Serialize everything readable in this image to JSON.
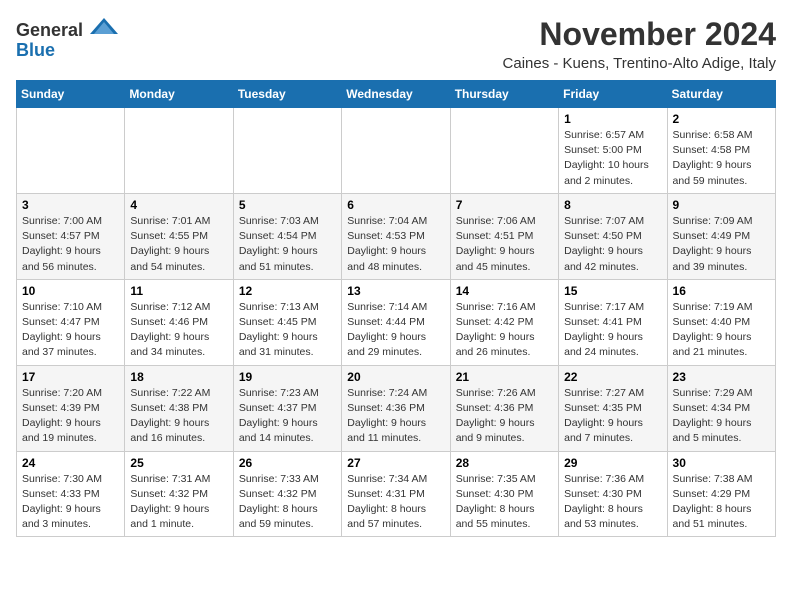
{
  "logo": {
    "general": "General",
    "blue": "Blue"
  },
  "title": "November 2024",
  "subtitle": "Caines - Kuens, Trentino-Alto Adige, Italy",
  "days_of_week": [
    "Sunday",
    "Monday",
    "Tuesday",
    "Wednesday",
    "Thursday",
    "Friday",
    "Saturday"
  ],
  "weeks": [
    [
      {
        "day": "",
        "detail": ""
      },
      {
        "day": "",
        "detail": ""
      },
      {
        "day": "",
        "detail": ""
      },
      {
        "day": "",
        "detail": ""
      },
      {
        "day": "",
        "detail": ""
      },
      {
        "day": "1",
        "detail": "Sunrise: 6:57 AM\nSunset: 5:00 PM\nDaylight: 10 hours and 2 minutes."
      },
      {
        "day": "2",
        "detail": "Sunrise: 6:58 AM\nSunset: 4:58 PM\nDaylight: 9 hours and 59 minutes."
      }
    ],
    [
      {
        "day": "3",
        "detail": "Sunrise: 7:00 AM\nSunset: 4:57 PM\nDaylight: 9 hours and 56 minutes."
      },
      {
        "day": "4",
        "detail": "Sunrise: 7:01 AM\nSunset: 4:55 PM\nDaylight: 9 hours and 54 minutes."
      },
      {
        "day": "5",
        "detail": "Sunrise: 7:03 AM\nSunset: 4:54 PM\nDaylight: 9 hours and 51 minutes."
      },
      {
        "day": "6",
        "detail": "Sunrise: 7:04 AM\nSunset: 4:53 PM\nDaylight: 9 hours and 48 minutes."
      },
      {
        "day": "7",
        "detail": "Sunrise: 7:06 AM\nSunset: 4:51 PM\nDaylight: 9 hours and 45 minutes."
      },
      {
        "day": "8",
        "detail": "Sunrise: 7:07 AM\nSunset: 4:50 PM\nDaylight: 9 hours and 42 minutes."
      },
      {
        "day": "9",
        "detail": "Sunrise: 7:09 AM\nSunset: 4:49 PM\nDaylight: 9 hours and 39 minutes."
      }
    ],
    [
      {
        "day": "10",
        "detail": "Sunrise: 7:10 AM\nSunset: 4:47 PM\nDaylight: 9 hours and 37 minutes."
      },
      {
        "day": "11",
        "detail": "Sunrise: 7:12 AM\nSunset: 4:46 PM\nDaylight: 9 hours and 34 minutes."
      },
      {
        "day": "12",
        "detail": "Sunrise: 7:13 AM\nSunset: 4:45 PM\nDaylight: 9 hours and 31 minutes."
      },
      {
        "day": "13",
        "detail": "Sunrise: 7:14 AM\nSunset: 4:44 PM\nDaylight: 9 hours and 29 minutes."
      },
      {
        "day": "14",
        "detail": "Sunrise: 7:16 AM\nSunset: 4:42 PM\nDaylight: 9 hours and 26 minutes."
      },
      {
        "day": "15",
        "detail": "Sunrise: 7:17 AM\nSunset: 4:41 PM\nDaylight: 9 hours and 24 minutes."
      },
      {
        "day": "16",
        "detail": "Sunrise: 7:19 AM\nSunset: 4:40 PM\nDaylight: 9 hours and 21 minutes."
      }
    ],
    [
      {
        "day": "17",
        "detail": "Sunrise: 7:20 AM\nSunset: 4:39 PM\nDaylight: 9 hours and 19 minutes."
      },
      {
        "day": "18",
        "detail": "Sunrise: 7:22 AM\nSunset: 4:38 PM\nDaylight: 9 hours and 16 minutes."
      },
      {
        "day": "19",
        "detail": "Sunrise: 7:23 AM\nSunset: 4:37 PM\nDaylight: 9 hours and 14 minutes."
      },
      {
        "day": "20",
        "detail": "Sunrise: 7:24 AM\nSunset: 4:36 PM\nDaylight: 9 hours and 11 minutes."
      },
      {
        "day": "21",
        "detail": "Sunrise: 7:26 AM\nSunset: 4:36 PM\nDaylight: 9 hours and 9 minutes."
      },
      {
        "day": "22",
        "detail": "Sunrise: 7:27 AM\nSunset: 4:35 PM\nDaylight: 9 hours and 7 minutes."
      },
      {
        "day": "23",
        "detail": "Sunrise: 7:29 AM\nSunset: 4:34 PM\nDaylight: 9 hours and 5 minutes."
      }
    ],
    [
      {
        "day": "24",
        "detail": "Sunrise: 7:30 AM\nSunset: 4:33 PM\nDaylight: 9 hours and 3 minutes."
      },
      {
        "day": "25",
        "detail": "Sunrise: 7:31 AM\nSunset: 4:32 PM\nDaylight: 9 hours and 1 minute."
      },
      {
        "day": "26",
        "detail": "Sunrise: 7:33 AM\nSunset: 4:32 PM\nDaylight: 8 hours and 59 minutes."
      },
      {
        "day": "27",
        "detail": "Sunrise: 7:34 AM\nSunset: 4:31 PM\nDaylight: 8 hours and 57 minutes."
      },
      {
        "day": "28",
        "detail": "Sunrise: 7:35 AM\nSunset: 4:30 PM\nDaylight: 8 hours and 55 minutes."
      },
      {
        "day": "29",
        "detail": "Sunrise: 7:36 AM\nSunset: 4:30 PM\nDaylight: 8 hours and 53 minutes."
      },
      {
        "day": "30",
        "detail": "Sunrise: 7:38 AM\nSunset: 4:29 PM\nDaylight: 8 hours and 51 minutes."
      }
    ]
  ]
}
